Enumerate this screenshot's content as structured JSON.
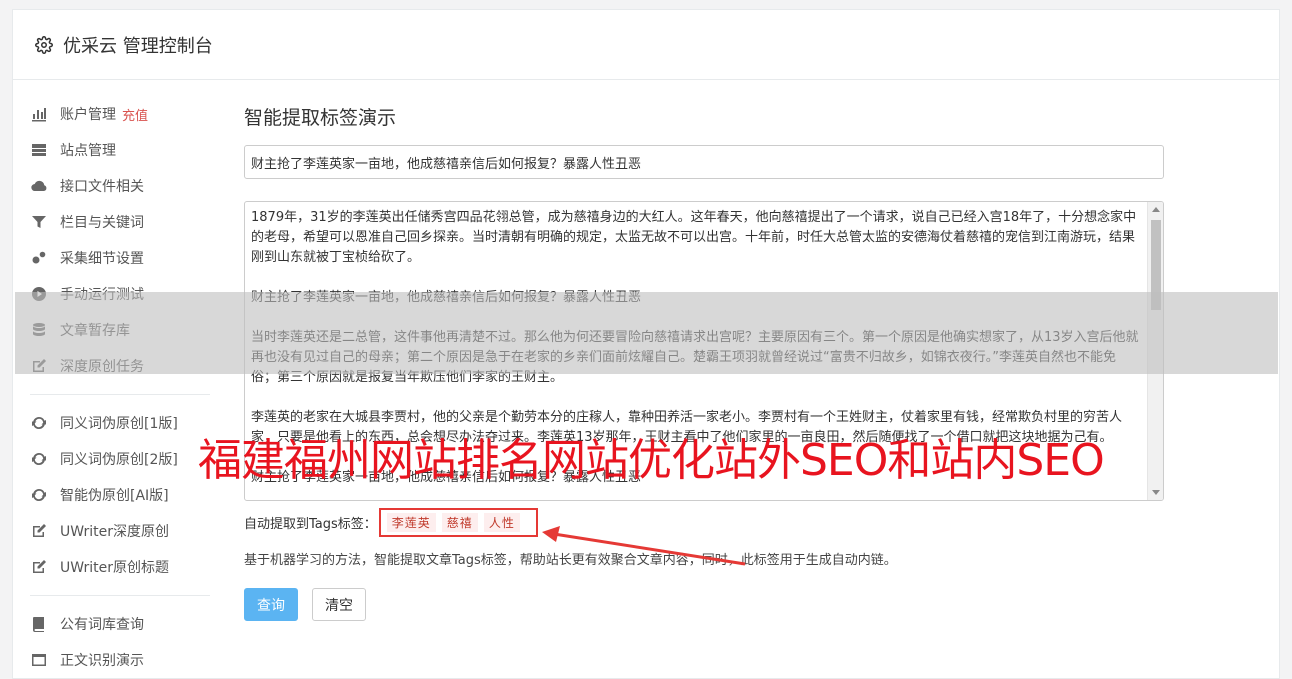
{
  "header": {
    "title": "优采云 管理控制台",
    "icon": "gear-icon"
  },
  "sidebar": {
    "group1": [
      {
        "label": "账户管理",
        "badge": "充值",
        "icon": "bar-chart-icon"
      },
      {
        "label": "站点管理",
        "icon": "server-icon"
      },
      {
        "label": "接口文件相关",
        "icon": "cloud-upload-icon"
      },
      {
        "label": "栏目与关键词",
        "icon": "filter-icon"
      },
      {
        "label": "采集细节设置",
        "icon": "cogs-icon"
      },
      {
        "label": "手动运行测试",
        "icon": "play-circle-icon"
      },
      {
        "label": "文章暂存库",
        "icon": "database-icon"
      },
      {
        "label": "深度原创任务",
        "icon": "edit-icon"
      }
    ],
    "group2": [
      {
        "label": "同义词伪原创[1版]",
        "icon": "refresh-icon"
      },
      {
        "label": "同义词伪原创[2版]",
        "icon": "refresh-icon"
      },
      {
        "label": "智能伪原创[AI版]",
        "icon": "refresh-icon"
      },
      {
        "label": "UWriter深度原创",
        "icon": "edit-icon"
      },
      {
        "label": "UWriter原创标题",
        "icon": "edit-icon"
      }
    ],
    "group3": [
      {
        "label": "公有词库查询",
        "icon": "book-icon"
      },
      {
        "label": "正文识别演示",
        "icon": "window-icon"
      }
    ]
  },
  "main": {
    "heading": "智能提取标签演示",
    "title_value": "财主抢了李莲英家一亩地，他成慈禧亲信后如何报复？暴露人性丑恶",
    "content_paragraphs": [
      "1879年，31岁的李莲英出任储秀宫四品花翎总管，成为慈禧身边的大红人。这年春天，他向慈禧提出了一个请求，说自己已经入宫18年了，十分想念家中的老母，希望可以恩准自己回乡探亲。当时清朝有明确的规定，太监无故不可以出宫。十年前，时任大总管太监的安德海仗着慈禧的宠信到江南游玩，结果刚到山东就被丁宝桢给砍了。",
      "财主抢了李莲英家一亩地，他成慈禧亲信后如何报复？暴露人性丑恶",
      "当时李莲英还是二总管，这件事他再清楚不过。那么他为何还要冒险向慈禧请求出宫呢？主要原因有三个。第一个原因是他确实想家了，从13岁入宫后他就再也没有见过自己的母亲；第二个原因是急于在老家的乡亲们面前炫耀自己。楚霸王项羽就曾经说过“富贵不归故乡，如锦衣夜行。”李莲英自然也不能免俗；第三个原因就是报复当年欺压他们李家的王财主。",
      "李莲英的老家在大城县李贾村，他的父亲是个勤劳本分的庄稼人，靠种田养活一家老小。李贾村有一个王姓财主，仗着家里有钱，经常欺负村里的穷苦人家，只要是他看上的东西，总会想尽办法夺过来。李莲英13岁那年，王财主看中了他们家里的一亩良田，然后随便找了一个借口就把这块地据为己有。",
      "财主抢了李莲英家一亩地，他成慈禧亲信后如何报复？暴露人性丑恶"
    ],
    "tags_label": "自动提取到Tags标签：",
    "tags": [
      "李莲英",
      "慈禧",
      "人性"
    ],
    "description": "基于机器学习的方法，智能提取文章Tags标签，帮助站长更有效聚合文章内容，同时，此标签用于生成自动内链。",
    "query_button": "查询",
    "clear_button": "清空"
  },
  "overlay": {
    "watermark_text": "福建福州网站排名网站优化站外SEO和站内SEO"
  }
}
